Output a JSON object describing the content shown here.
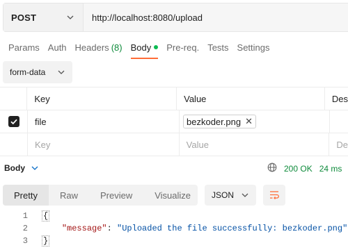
{
  "request": {
    "method": "POST",
    "url": "http://localhost:8080/upload"
  },
  "tabs": [
    {
      "label": "Params"
    },
    {
      "label": "Auth"
    },
    {
      "label": "Headers",
      "count": "(8)"
    },
    {
      "label": "Body"
    },
    {
      "label": "Pre-req."
    },
    {
      "label": "Tests"
    },
    {
      "label": "Settings"
    }
  ],
  "body_type": "form-data",
  "table": {
    "headers": [
      "Key",
      "Value",
      "Des"
    ],
    "rows": [
      {
        "checked": true,
        "key": "file",
        "value": "bezkoder.png"
      }
    ],
    "placeholder": {
      "key": "Key",
      "value": "Value",
      "description": "De"
    }
  },
  "response": {
    "title": "Body",
    "status": "200 OK",
    "time": "24 ms",
    "tabs": [
      "Pretty",
      "Raw",
      "Preview",
      "Visualize"
    ],
    "format": "JSON",
    "lines": [
      {
        "num": "1",
        "text": "{"
      },
      {
        "num": "2",
        "key": "\"message\"",
        "sep": ": ",
        "value": "\"Uploaded the file successfully: bezkoder.png\""
      },
      {
        "num": "3",
        "text": "}"
      }
    ]
  },
  "colors": {
    "accent": "#ff6c37",
    "success": "#0d8a3a",
    "body_dot": "#0cbb52"
  }
}
